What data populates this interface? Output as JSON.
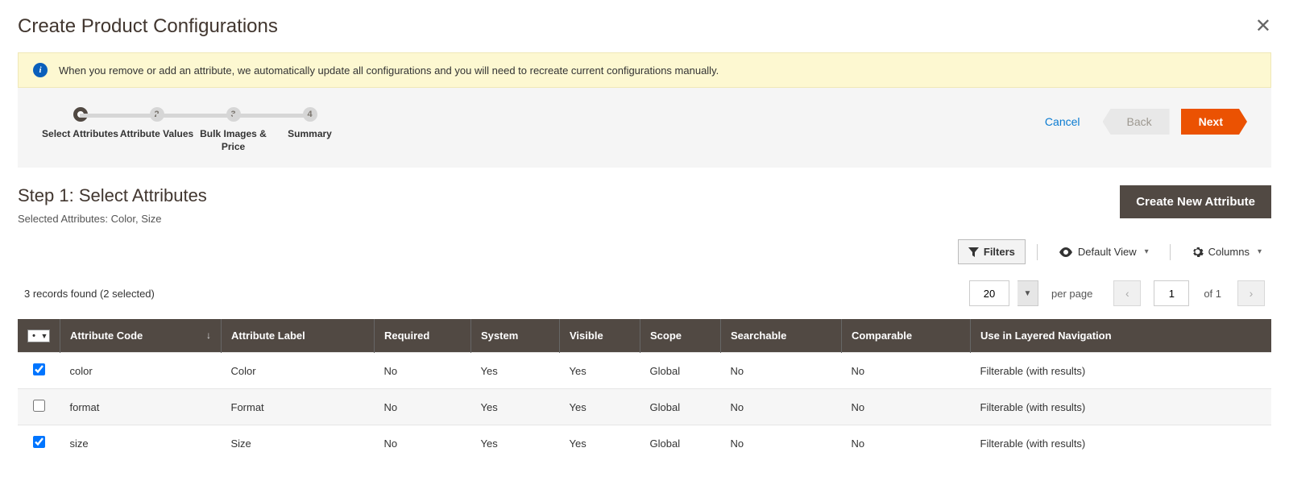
{
  "header": {
    "title": "Create Product Configurations"
  },
  "notice": {
    "text": "When you remove or add an attribute, we automatically update all configurations and you will need to recreate current configurations manually."
  },
  "wizard": {
    "steps": [
      {
        "label": "Select Attributes"
      },
      {
        "num": "2",
        "label": "Attribute Values"
      },
      {
        "num": "3",
        "label": "Bulk Images & Price"
      },
      {
        "num": "4",
        "label": "Summary"
      }
    ],
    "cancel": "Cancel",
    "back": "Back",
    "next": "Next"
  },
  "step": {
    "title": "Step 1: Select Attributes",
    "selected_label": "Selected Attributes: Color, Size",
    "create_btn": "Create New Attribute"
  },
  "toolbar": {
    "filters": "Filters",
    "default_view": "Default View",
    "columns": "Columns"
  },
  "meta": {
    "records_found": "3 records found (2 selected)",
    "per_page": "20",
    "per_page_label": "per page",
    "page": "1",
    "of_label": "of 1"
  },
  "columns": {
    "code": "Attribute Code",
    "label": "Attribute Label",
    "required": "Required",
    "system": "System",
    "visible": "Visible",
    "scope": "Scope",
    "searchable": "Searchable",
    "comparable": "Comparable",
    "layered": "Use in Layered Navigation"
  },
  "rows": [
    {
      "checked": true,
      "code": "color",
      "label": "Color",
      "required": "No",
      "system": "Yes",
      "visible": "Yes",
      "scope": "Global",
      "searchable": "No",
      "comparable": "No",
      "layered": "Filterable (with results)"
    },
    {
      "checked": false,
      "code": "format",
      "label": "Format",
      "required": "No",
      "system": "Yes",
      "visible": "Yes",
      "scope": "Global",
      "searchable": "No",
      "comparable": "No",
      "layered": "Filterable (with results)"
    },
    {
      "checked": true,
      "code": "size",
      "label": "Size",
      "required": "No",
      "system": "Yes",
      "visible": "Yes",
      "scope": "Global",
      "searchable": "No",
      "comparable": "No",
      "layered": "Filterable (with results)"
    }
  ]
}
